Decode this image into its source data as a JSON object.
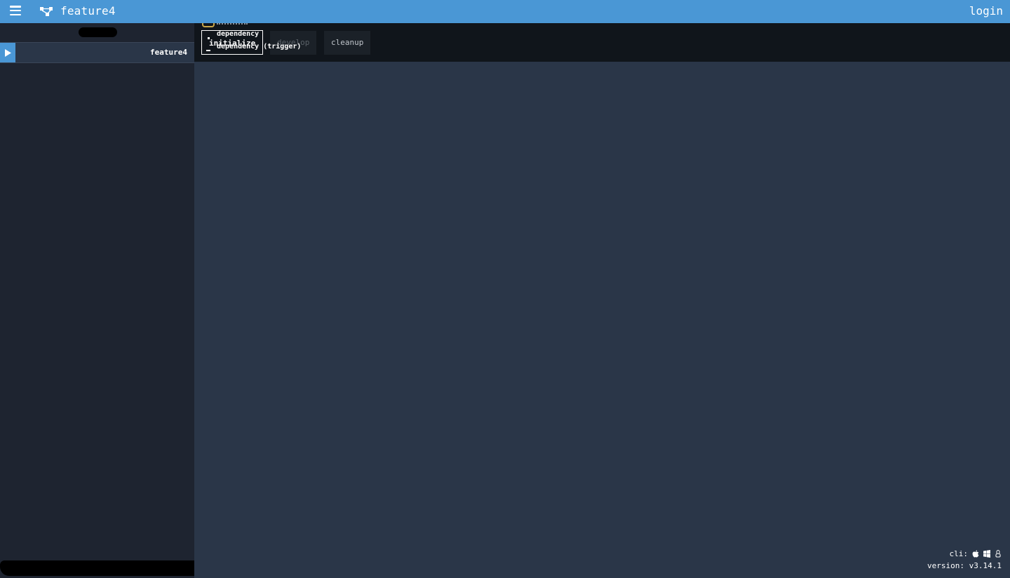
{
  "header": {
    "pipeline_name": "feature4",
    "login_label": "login"
  },
  "sidebar": {
    "pipelines": [
      {
        "name": "feature4"
      }
    ]
  },
  "groups": [
    {
      "label": "initialize"
    },
    {
      "label": "develop"
    },
    {
      "label": "cleanup"
    }
  ],
  "job": {
    "name": "initialize",
    "input_top": "dependency",
    "input_bottom": "dependency (trigger)"
  },
  "footer": {
    "cli_label": "cli:",
    "version_label": "version: v3.14.1"
  },
  "colors": {
    "topbar": "#4a97d5",
    "sidebar": "#1e2430",
    "main": "#2a3648",
    "groups_bar": "#10151b"
  }
}
